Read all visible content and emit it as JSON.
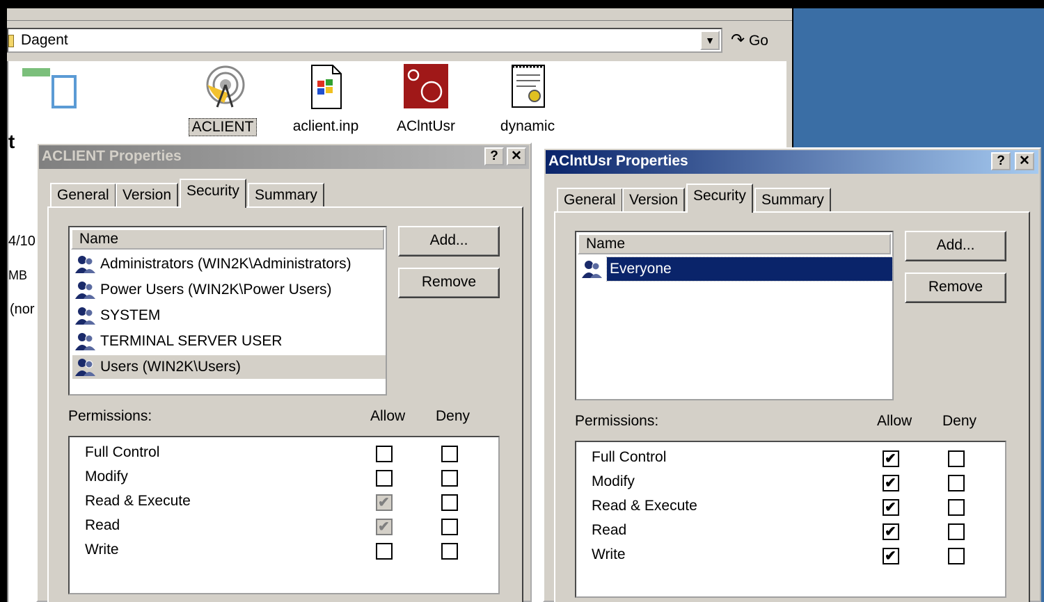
{
  "explorer": {
    "address": "Dagent",
    "go_label": "Go",
    "truncated_title": "t",
    "info_lines": [
      "4/10",
      "MB",
      "(nor"
    ],
    "files": [
      {
        "name": "ACLIENT",
        "icon": "satellite-dish-icon",
        "selected": true
      },
      {
        "name": "aclient.inp",
        "icon": "windows-setup-file-icon",
        "selected": false
      },
      {
        "name": "AClntUsr",
        "icon": "red-user-icon",
        "selected": false
      },
      {
        "name": "dynamic",
        "icon": "text-document-icon",
        "selected": false
      }
    ]
  },
  "dialog_left": {
    "title": "ACLIENT Properties",
    "help_label": "?",
    "close_label": "✕",
    "tabs": [
      "General",
      "Version",
      "Security",
      "Summary"
    ],
    "selected_tab": "Security",
    "name_header": "Name",
    "names": [
      "Administrators (WIN2K\\Administrators)",
      "Power Users (WIN2K\\Power Users)",
      "SYSTEM",
      "TERMINAL SERVER USER",
      "Users (WIN2K\\Users)"
    ],
    "add_label": "Add...",
    "remove_label": "Remove",
    "permissions_label": "Permissions:",
    "allow_label": "Allow",
    "deny_label": "Deny",
    "permissions": [
      {
        "name": "Full Control",
        "allow": false,
        "deny": false,
        "inherited": false
      },
      {
        "name": "Modify",
        "allow": false,
        "deny": false,
        "inherited": false
      },
      {
        "name": "Read & Execute",
        "allow": true,
        "deny": false,
        "inherited": true
      },
      {
        "name": "Read",
        "allow": true,
        "deny": false,
        "inherited": true
      },
      {
        "name": "Write",
        "allow": false,
        "deny": false,
        "inherited": false
      }
    ]
  },
  "dialog_right": {
    "title": "AClntUsr Properties",
    "help_label": "?",
    "close_label": "✕",
    "tabs": [
      "General",
      "Version",
      "Security",
      "Summary"
    ],
    "selected_tab": "Security",
    "name_header": "Name",
    "names": [
      "Everyone"
    ],
    "add_label": "Add...",
    "remove_label": "Remove",
    "permissions_label": "Permissions:",
    "allow_label": "Allow",
    "deny_label": "Deny",
    "permissions": [
      {
        "name": "Full Control",
        "allow": true,
        "deny": false
      },
      {
        "name": "Modify",
        "allow": true,
        "deny": false
      },
      {
        "name": "Read & Execute",
        "allow": true,
        "deny": false
      },
      {
        "name": "Read",
        "allow": true,
        "deny": false
      },
      {
        "name": "Write",
        "allow": true,
        "deny": false
      }
    ]
  },
  "colors": {
    "desktop": "#3a6ea5",
    "active_title": "#0a246a",
    "inactive_title": "#808080",
    "face": "#d4d0c8"
  }
}
